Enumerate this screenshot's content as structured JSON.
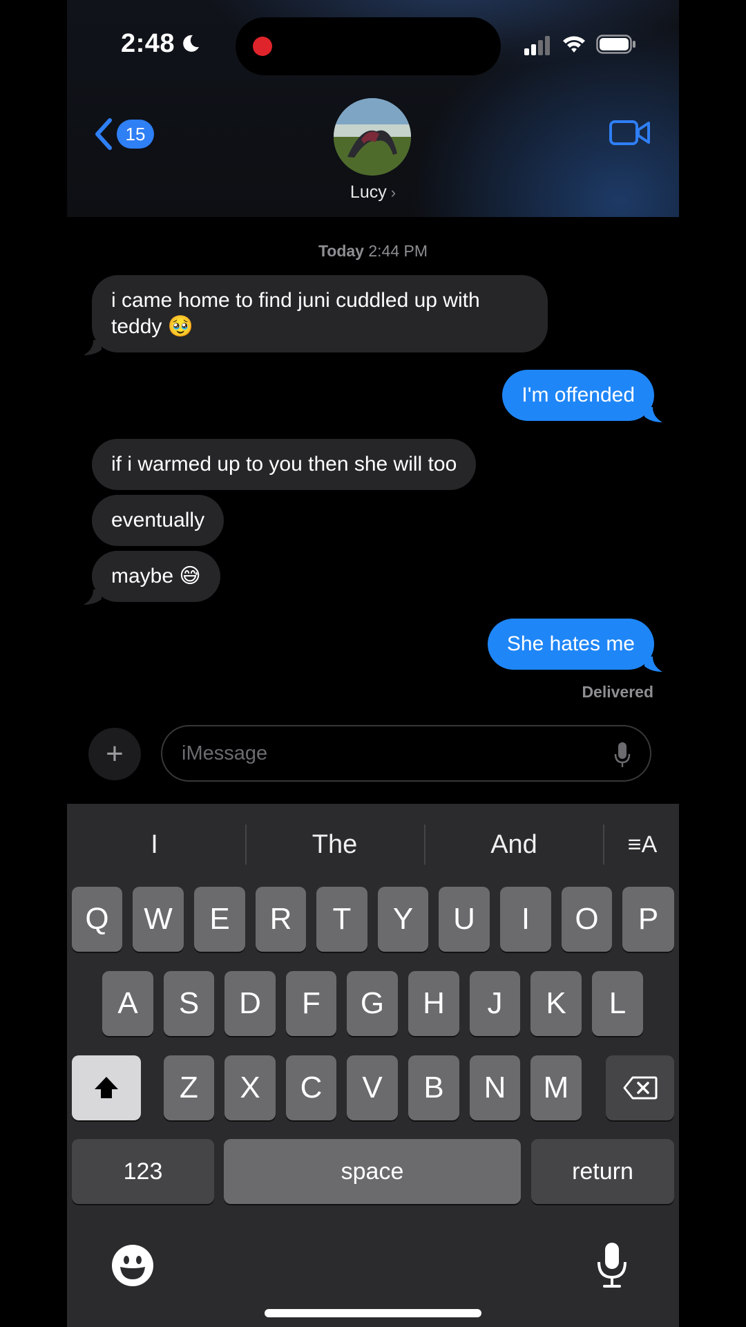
{
  "status_bar": {
    "time": "2:48",
    "icons": [
      "moon-icon",
      "recording-dot-icon",
      "cellular-signal-icon",
      "wifi-icon",
      "battery-icon"
    ]
  },
  "header": {
    "back_count": "15",
    "contact_name": "Lucy",
    "name_chevron": "›",
    "video_icon": "video-camera-icon"
  },
  "conversation": {
    "timestamp_day": "Today",
    "timestamp_time": "2:44 PM",
    "messages": [
      {
        "direction": "incoming",
        "text": "i came home to find juni cuddled up with teddy 🥹"
      },
      {
        "direction": "outgoing",
        "text": "I'm offended"
      },
      {
        "direction": "incoming",
        "text": "if i warmed up to you then she will too"
      },
      {
        "direction": "incoming",
        "text": "eventually"
      },
      {
        "direction": "incoming",
        "text": "maybe 😅"
      },
      {
        "direction": "outgoing",
        "text": "She hates me"
      }
    ],
    "delivery_status": "Delivered"
  },
  "input_bar": {
    "plus_label": "+",
    "placeholder": "iMessage"
  },
  "keyboard": {
    "suggestions": [
      "I",
      "The",
      "And"
    ],
    "format_icon_label": "≡A",
    "row1": [
      "Q",
      "W",
      "E",
      "R",
      "T",
      "Y",
      "U",
      "I",
      "O",
      "P"
    ],
    "row2": [
      "A",
      "S",
      "D",
      "F",
      "G",
      "H",
      "J",
      "K",
      "L"
    ],
    "row3": [
      "Z",
      "X",
      "C",
      "V",
      "B",
      "N",
      "M"
    ],
    "numbers_label": "123",
    "space_label": "space",
    "return_label": "return"
  },
  "colors": {
    "accent_blue": "#1f86f7",
    "incoming_bubble": "#262628",
    "background": "#000000",
    "keyboard_bg": "#2b2b2d"
  }
}
